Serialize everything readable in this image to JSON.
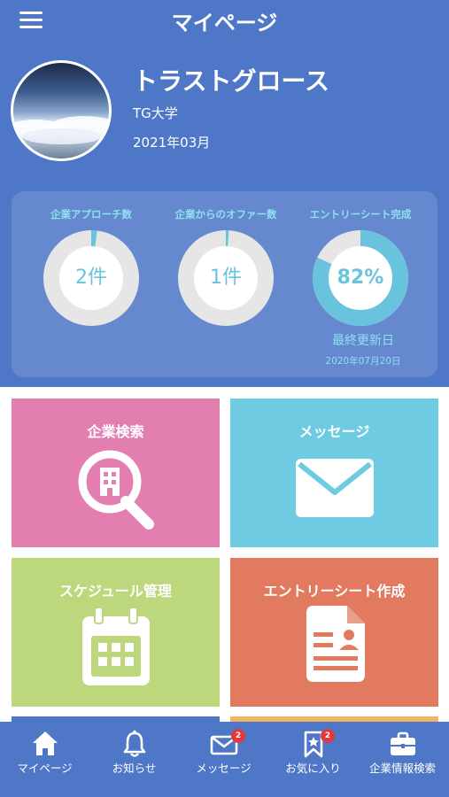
{
  "header": {
    "title": "マイページ"
  },
  "profile": {
    "name": "トラストグロース",
    "school": "TG大学",
    "grad_date": "2021年03月"
  },
  "stats": [
    {
      "label": "企業アプローチ数",
      "value": "2件",
      "fill_fraction": 0.02
    },
    {
      "label": "企業からのオファー数",
      "value": "1件",
      "fill_fraction": 0.01
    },
    {
      "label": "エントリーシート完成",
      "value": "82%",
      "fill_fraction": 0.82
    }
  ],
  "updated": {
    "label": "最終更新日",
    "date": "2020年07月20日"
  },
  "tiles": [
    {
      "label": "企業検索",
      "color": "#e37eb0"
    },
    {
      "label": "メッセージ",
      "color": "#6ecbe2"
    },
    {
      "label": "スケジュール管理",
      "color": "#bcd77c"
    },
    {
      "label": "エントリーシート作成",
      "color": "#e17a5f"
    }
  ],
  "colors": {
    "header": "#4f77c8",
    "ring_track": "#e6e6e6",
    "ring_fill": "#6ac3dc",
    "badge": "#e23a3a"
  },
  "bottom_nav": [
    {
      "label": "マイページ",
      "icon": "home-icon"
    },
    {
      "label": "お知らせ",
      "icon": "bell-icon"
    },
    {
      "label": "メッセージ",
      "icon": "envelope-icon",
      "badge": "2"
    },
    {
      "label": "お気に入り",
      "icon": "bookmark-star-icon",
      "badge": "2"
    },
    {
      "label": "企業情報検索",
      "icon": "briefcase-icon"
    }
  ]
}
